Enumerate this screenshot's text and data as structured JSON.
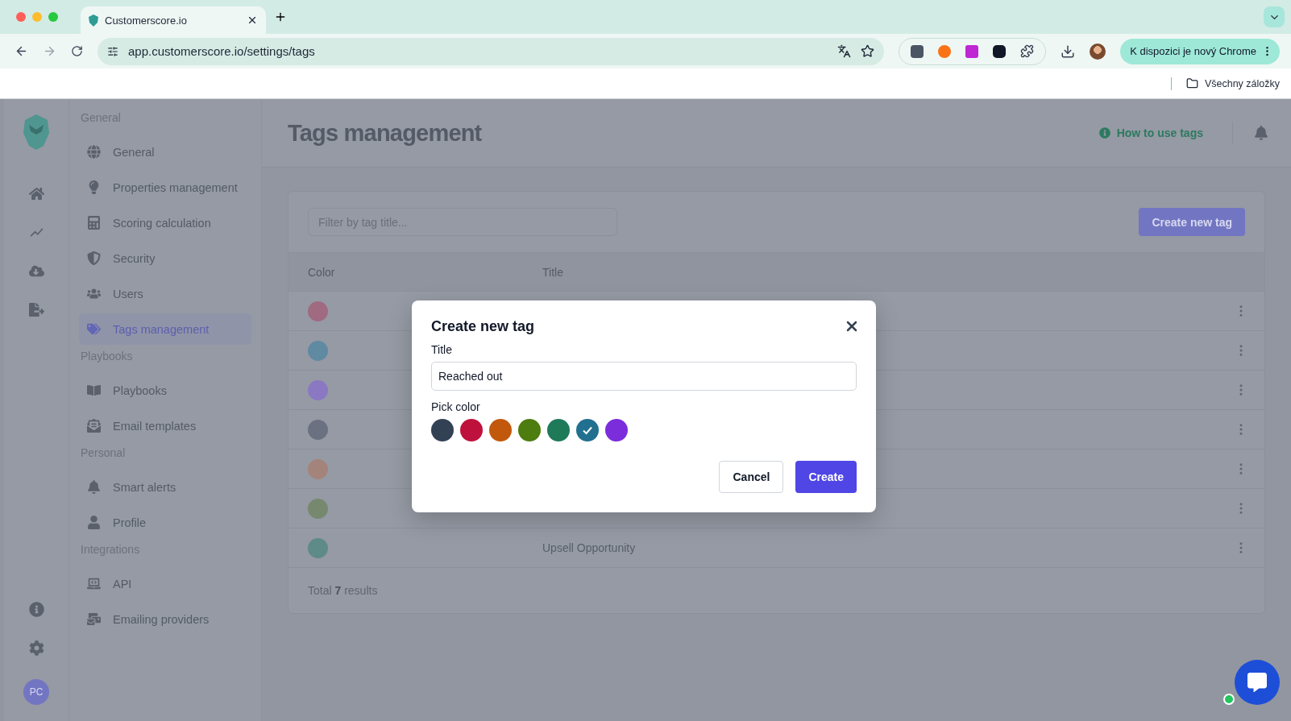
{
  "browser": {
    "tab_title": "Customerscore.io",
    "url": "app.customerscore.io/settings/tags",
    "update_button": "K dispozici je nový Chrome",
    "bookmarks_folder": "Všechny záložky"
  },
  "sidebar": {
    "avatar": "PC",
    "sections": [
      {
        "heading": "General",
        "items": [
          {
            "label": "General",
            "selected": false
          },
          {
            "label": "Properties management",
            "selected": false
          },
          {
            "label": "Scoring calculation",
            "selected": false
          },
          {
            "label": "Security",
            "selected": false
          },
          {
            "label": "Users",
            "selected": false
          },
          {
            "label": "Tags management",
            "selected": true
          }
        ]
      },
      {
        "heading": "Playbooks",
        "items": [
          {
            "label": "Playbooks",
            "selected": false
          },
          {
            "label": "Email templates",
            "selected": false
          }
        ]
      },
      {
        "heading": "Personal",
        "items": [
          {
            "label": "Smart alerts",
            "selected": false
          },
          {
            "label": "Profile",
            "selected": false
          }
        ]
      },
      {
        "heading": "Integrations",
        "items": [
          {
            "label": "API",
            "selected": false
          },
          {
            "label": "Emailing providers",
            "selected": false
          }
        ]
      }
    ]
  },
  "page": {
    "title": "Tags management",
    "help_link": "How to use tags",
    "filter": {
      "placeholder": "Filter by tag title..."
    },
    "create_button": "Create new tag",
    "table": {
      "columns": [
        "Color",
        "Title"
      ],
      "rows": [
        {
          "color": "#a06a80"
        },
        {
          "color": "#5f8aa2"
        },
        {
          "color": "#8a78c2"
        },
        {
          "color": "#6b7180"
        },
        {
          "color": "#a4847a"
        },
        {
          "color": "#76886e"
        },
        {
          "color": "#5e8a88",
          "title": "Upsell Opportunity"
        }
      ]
    },
    "footer": "Total **7** results"
  },
  "modal": {
    "title": "Create new tag",
    "field_label": "Title",
    "field_value": "Reached out",
    "color_label": "Pick color",
    "colors": [
      {
        "color": "#334155",
        "selected": false
      },
      {
        "color": "#be123c",
        "selected": false
      },
      {
        "color": "#c2580c",
        "selected": false
      },
      {
        "color": "#4d7c0f",
        "selected": false
      },
      {
        "color": "#1f7a5a",
        "selected": false
      },
      {
        "color": "#21708f",
        "selected": true
      },
      {
        "color": "#7c2ddb",
        "selected": false
      }
    ],
    "cancel": "Cancel",
    "create": "Create"
  }
}
